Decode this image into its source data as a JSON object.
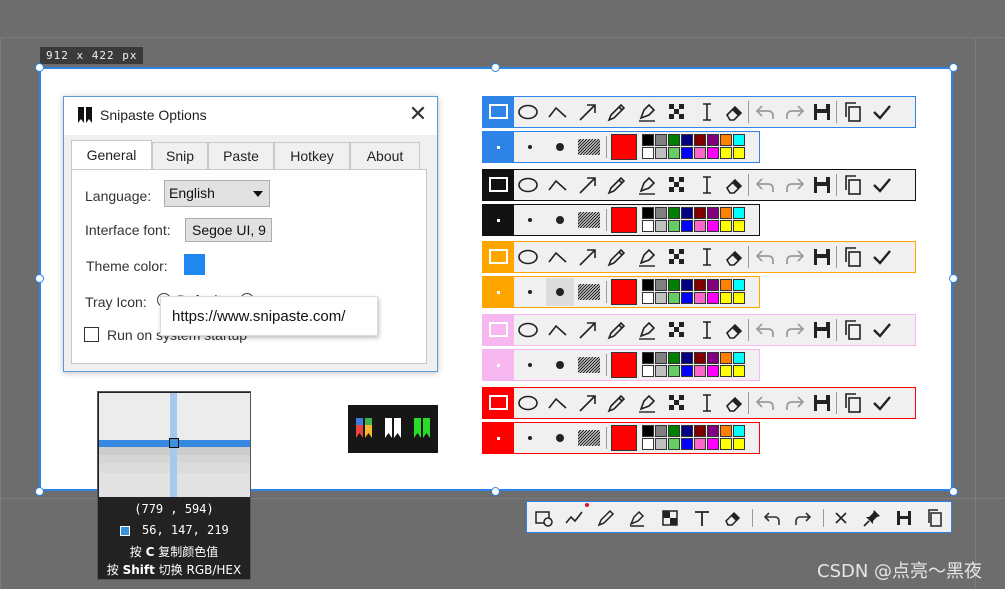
{
  "selection": {
    "size_label": "912 x 422  px"
  },
  "options_window": {
    "title": "Snipaste Options",
    "close_glyph": "✕",
    "tabs": [
      "General",
      "Snip",
      "Paste",
      "Hotkey",
      "About"
    ],
    "active_tab": "General",
    "language_label": "Language:",
    "language_value": "English",
    "font_label": "Interface font:",
    "font_value": "Segoe UI, 9",
    "theme_label": "Theme color:",
    "theme_color": "#1e87f0",
    "tray_label": "Tray Icon:",
    "tray_option_default": "Default",
    "run_startup_label": "Run on system startup"
  },
  "tooltip": {
    "text": "https://www.snipaste.com/"
  },
  "magnifier": {
    "coord": "(779 , 594)",
    "rgb": "56, 147, 219",
    "hint1_prefix": "按 ",
    "hint1_key": "C",
    "hint1_suffix": " 复制颜色值",
    "hint2_prefix": "按 ",
    "hint2_key": "Shift",
    "hint2_suffix": " 切换 RGB/HEX"
  },
  "toolbar_themes": [
    {
      "name": "blue",
      "color": "#2e83e6"
    },
    {
      "name": "black",
      "color": "#111111"
    },
    {
      "name": "orange",
      "color": "#ffa500"
    },
    {
      "name": "pink",
      "color": "#f7b8f2"
    },
    {
      "name": "red",
      "color": "#ff0000"
    }
  ],
  "toolbar_tools": [
    "rectangle",
    "ellipse",
    "polyline",
    "arrow",
    "pencil",
    "marker",
    "mosaic",
    "text",
    "eraser",
    "undo",
    "redo",
    "save",
    "copy",
    "done"
  ],
  "palette_top": [
    "#000000",
    "#808080",
    "#008000",
    "#000080",
    "#800000",
    "#800080",
    "#ff8000",
    "#00ffff"
  ],
  "palette_bottom": [
    "#ffffff",
    "#c0c0c0",
    "#66cc66",
    "#0000ff",
    "#ff66cc",
    "#ff00ff",
    "#ffff00",
    "#ffff00"
  ],
  "bottom_toolbar": [
    "shape",
    "polyline",
    "pencil",
    "marker",
    "mosaic",
    "text",
    "eraser",
    "undo",
    "redo",
    "close",
    "pin",
    "save",
    "copy"
  ],
  "watermark": "CSDN @点亮～黑夜"
}
